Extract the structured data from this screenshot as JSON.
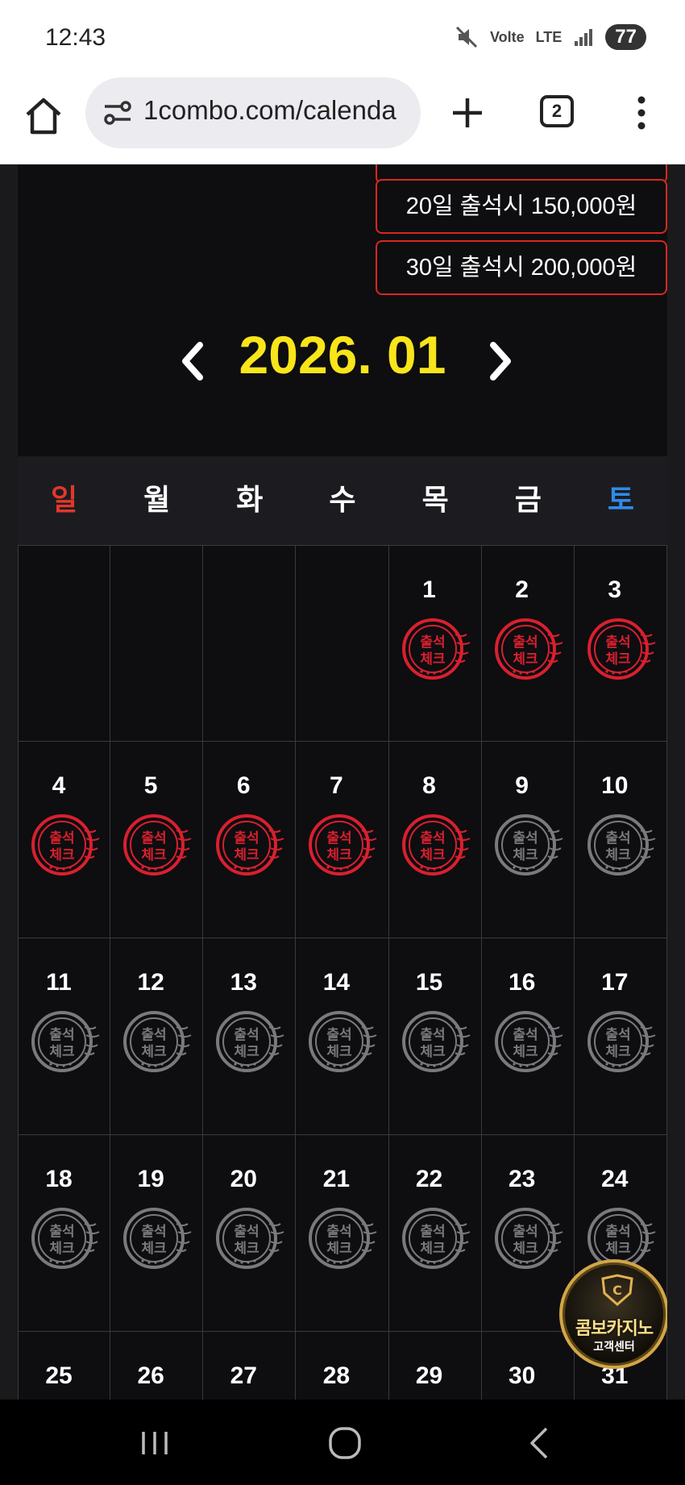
{
  "status_bar": {
    "time": "12:43",
    "signal_labels": [
      "Volte",
      "LTE"
    ],
    "battery": "77"
  },
  "browser": {
    "url": "1combo.com/calenda",
    "tab_count": "2"
  },
  "rewards": [
    {
      "label": "20일 출석시 150,000원"
    },
    {
      "label": "30일 출석시 200,000원"
    }
  ],
  "calendar": {
    "title": "2026. 01",
    "weekdays": [
      "일",
      "월",
      "화",
      "수",
      "목",
      "금",
      "토"
    ],
    "weekday_colors": [
      "#e2372b",
      "#ffffff",
      "#ffffff",
      "#ffffff",
      "#ffffff",
      "#ffffff",
      "#2f8bea"
    ],
    "stamp_text": [
      "출석",
      "체크"
    ],
    "stamp_colors": {
      "checked": "#d8202e",
      "unchecked": "#7a7a7e"
    },
    "weeks": [
      [
        null,
        null,
        null,
        null,
        {
          "day": "1",
          "checked": true
        },
        {
          "day": "2",
          "checked": true
        },
        {
          "day": "3",
          "checked": true
        }
      ],
      [
        {
          "day": "4",
          "checked": true
        },
        {
          "day": "5",
          "checked": true
        },
        {
          "day": "6",
          "checked": true
        },
        {
          "day": "7",
          "checked": true
        },
        {
          "day": "8",
          "checked": true
        },
        {
          "day": "9",
          "checked": false
        },
        {
          "day": "10",
          "checked": false
        }
      ],
      [
        {
          "day": "11",
          "checked": false
        },
        {
          "day": "12",
          "checked": false
        },
        {
          "day": "13",
          "checked": false
        },
        {
          "day": "14",
          "checked": false
        },
        {
          "day": "15",
          "checked": false
        },
        {
          "day": "16",
          "checked": false
        },
        {
          "day": "17",
          "checked": false
        }
      ],
      [
        {
          "day": "18",
          "checked": false
        },
        {
          "day": "19",
          "checked": false
        },
        {
          "day": "20",
          "checked": false
        },
        {
          "day": "21",
          "checked": false
        },
        {
          "day": "22",
          "checked": false
        },
        {
          "day": "23",
          "checked": false
        },
        {
          "day": "24",
          "checked": false
        }
      ],
      [
        {
          "day": "25",
          "checked": false
        },
        {
          "day": "26",
          "checked": false
        },
        {
          "day": "27",
          "checked": false
        },
        {
          "day": "28",
          "checked": false
        },
        {
          "day": "29",
          "checked": false
        },
        {
          "day": "30",
          "checked": false
        },
        {
          "day": "31",
          "checked": false
        }
      ]
    ]
  },
  "support_badge": {
    "name": "콤보카지노",
    "sub": "고객센터"
  }
}
